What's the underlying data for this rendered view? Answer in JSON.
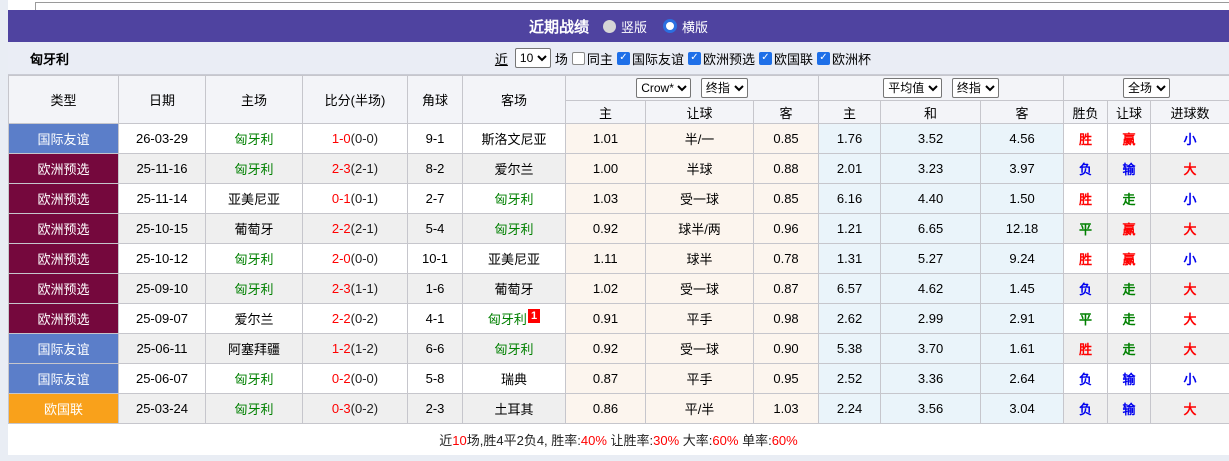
{
  "header": {
    "title": "近期战绩",
    "radio_vertical": "竖版",
    "radio_horizontal": "横版",
    "selected_layout": "横版"
  },
  "controls": {
    "team": "匈牙利",
    "recent_label": "近",
    "recent_count": "10",
    "matches_label": "场",
    "same_home": {
      "label": "同主",
      "checked": false
    },
    "filters": [
      {
        "label": "国际友谊",
        "checked": true
      },
      {
        "label": "欧洲预选",
        "checked": true
      },
      {
        "label": "欧国联",
        "checked": true
      },
      {
        "label": "欧洲杯",
        "checked": true
      }
    ]
  },
  "table": {
    "merged_headers": [
      "类型",
      "日期",
      "主场",
      "比分(半场)",
      "角球",
      "客场"
    ],
    "handicap_group": {
      "select_bookmaker": "Crow*",
      "select_stage": "终指",
      "cols": [
        "主",
        "让球",
        "客"
      ]
    },
    "europe_group": {
      "select_source": "平均值",
      "select_stage": "终指",
      "cols": [
        "主",
        "和",
        "客"
      ]
    },
    "result_group": {
      "select_scope": "全场",
      "cols": [
        "胜负",
        "让球",
        "进球数"
      ]
    },
    "rows": [
      {
        "type": "国际友谊",
        "type_class": "friendly",
        "date": "26-03-29",
        "home": "匈牙利",
        "home_green": true,
        "score": "1-0",
        "half": "(0-0)",
        "corner": "9-1",
        "away": "斯洛文尼亚",
        "away_green": false,
        "ah_home": "1.01",
        "ah_line": "半/一",
        "ah_away": "0.85",
        "eu_home": "1.76",
        "eu_draw": "3.52",
        "eu_away": "4.56",
        "res_wdl": "胜",
        "res_wdl_c": "red",
        "res_ah": "赢",
        "res_ah_c": "red",
        "res_goal": "小",
        "res_goal_c": "blue"
      },
      {
        "type": "欧洲预选",
        "type_class": "qualifier",
        "date": "25-11-16",
        "home": "匈牙利",
        "home_green": true,
        "score": "2-3",
        "half": "(2-1)",
        "corner": "8-2",
        "away": "爱尔兰",
        "away_green": false,
        "ah_home": "1.00",
        "ah_line": "半球",
        "ah_away": "0.88",
        "eu_home": "2.01",
        "eu_draw": "3.23",
        "eu_away": "3.97",
        "res_wdl": "负",
        "res_wdl_c": "blue",
        "res_ah": "输",
        "res_ah_c": "blue",
        "res_goal": "大",
        "res_goal_c": "red"
      },
      {
        "type": "欧洲预选",
        "type_class": "qualifier",
        "date": "25-11-14",
        "home": "亚美尼亚",
        "home_green": false,
        "score": "0-1",
        "half": "(0-1)",
        "corner": "2-7",
        "away": "匈牙利",
        "away_green": true,
        "ah_home": "1.03",
        "ah_line": "受一球",
        "ah_away": "0.85",
        "eu_home": "6.16",
        "eu_draw": "4.40",
        "eu_away": "1.50",
        "res_wdl": "胜",
        "res_wdl_c": "red",
        "res_ah": "走",
        "res_ah_c": "green",
        "res_goal": "小",
        "res_goal_c": "blue"
      },
      {
        "type": "欧洲预选",
        "type_class": "qualifier",
        "date": "25-10-15",
        "home": "葡萄牙",
        "home_green": false,
        "score": "2-2",
        "half": "(2-1)",
        "corner": "5-4",
        "away": "匈牙利",
        "away_green": true,
        "ah_home": "0.92",
        "ah_line": "球半/两",
        "ah_away": "0.96",
        "eu_home": "1.21",
        "eu_draw": "6.65",
        "eu_away": "12.18",
        "res_wdl": "平",
        "res_wdl_c": "green",
        "res_ah": "赢",
        "res_ah_c": "red",
        "res_goal": "大",
        "res_goal_c": "red"
      },
      {
        "type": "欧洲预选",
        "type_class": "qualifier",
        "date": "25-10-12",
        "home": "匈牙利",
        "home_green": true,
        "score": "2-0",
        "half": "(0-0)",
        "corner": "10-1",
        "away": "亚美尼亚",
        "away_green": false,
        "ah_home": "1.11",
        "ah_line": "球半",
        "ah_away": "0.78",
        "eu_home": "1.31",
        "eu_draw": "5.27",
        "eu_away": "9.24",
        "res_wdl": "胜",
        "res_wdl_c": "red",
        "res_ah": "赢",
        "res_ah_c": "red",
        "res_goal": "小",
        "res_goal_c": "blue"
      },
      {
        "type": "欧洲预选",
        "type_class": "qualifier",
        "date": "25-09-10",
        "home": "匈牙利",
        "home_green": true,
        "score": "2-3",
        "half": "(1-1)",
        "corner": "1-6",
        "away": "葡萄牙",
        "away_green": false,
        "ah_home": "1.02",
        "ah_line": "受一球",
        "ah_away": "0.87",
        "eu_home": "6.57",
        "eu_draw": "4.62",
        "eu_away": "1.45",
        "res_wdl": "负",
        "res_wdl_c": "blue",
        "res_ah": "走",
        "res_ah_c": "green",
        "res_goal": "大",
        "res_goal_c": "red"
      },
      {
        "type": "欧洲预选",
        "type_class": "qualifier",
        "date": "25-09-07",
        "home": "爱尔兰",
        "home_green": false,
        "score": "2-2",
        "half": "(0-2)",
        "corner": "4-1",
        "away": "匈牙利",
        "away_green": true,
        "away_badge": "1",
        "ah_home": "0.91",
        "ah_line": "平手",
        "ah_away": "0.98",
        "eu_home": "2.62",
        "eu_draw": "2.99",
        "eu_away": "2.91",
        "res_wdl": "平",
        "res_wdl_c": "green",
        "res_ah": "走",
        "res_ah_c": "green",
        "res_goal": "大",
        "res_goal_c": "red"
      },
      {
        "type": "国际友谊",
        "type_class": "friendly",
        "date": "25-06-11",
        "home": "阿塞拜疆",
        "home_green": false,
        "score": "1-2",
        "half": "(1-2)",
        "corner": "6-6",
        "away": "匈牙利",
        "away_green": true,
        "ah_home": "0.92",
        "ah_line": "受一球",
        "ah_away": "0.90",
        "eu_home": "5.38",
        "eu_draw": "3.70",
        "eu_away": "1.61",
        "res_wdl": "胜",
        "res_wdl_c": "red",
        "res_ah": "走",
        "res_ah_c": "green",
        "res_goal": "大",
        "res_goal_c": "red"
      },
      {
        "type": "国际友谊",
        "type_class": "friendly",
        "date": "25-06-07",
        "home": "匈牙利",
        "home_green": true,
        "score": "0-2",
        "half": "(0-0)",
        "corner": "5-8",
        "away": "瑞典",
        "away_green": false,
        "ah_home": "0.87",
        "ah_line": "平手",
        "ah_away": "0.95",
        "eu_home": "2.52",
        "eu_draw": "3.36",
        "eu_away": "2.64",
        "res_wdl": "负",
        "res_wdl_c": "blue",
        "res_ah": "输",
        "res_ah_c": "blue",
        "res_goal": "小",
        "res_goal_c": "blue"
      },
      {
        "type": "欧国联",
        "type_class": "nations",
        "date": "25-03-24",
        "home": "匈牙利",
        "home_green": true,
        "score": "0-3",
        "half": "(0-2)",
        "corner": "2-3",
        "away": "土耳其",
        "away_green": false,
        "ah_home": "0.86",
        "ah_line": "平/半",
        "ah_away": "1.03",
        "eu_home": "2.24",
        "eu_draw": "3.56",
        "eu_away": "3.04",
        "res_wdl": "负",
        "res_wdl_c": "blue",
        "res_ah": "输",
        "res_ah_c": "blue",
        "res_goal": "大",
        "res_goal_c": "red"
      }
    ]
  },
  "footer": {
    "segments": [
      {
        "t": "近",
        "red": false
      },
      {
        "t": "10",
        "red": true
      },
      {
        "t": "场,胜4平2负4, 胜率:",
        "red": false
      },
      {
        "t": "40%",
        "red": true
      },
      {
        "t": " 让胜率:",
        "red": false
      },
      {
        "t": "30%",
        "red": true
      },
      {
        "t": " 大率:",
        "red": false
      },
      {
        "t": "60%",
        "red": true
      },
      {
        "t": " 单率:",
        "red": false
      },
      {
        "t": "60%",
        "red": true
      }
    ]
  },
  "colors": {
    "header_purple": "#4f43a0",
    "friendly_blue": "#5b7ec9",
    "qualifier_maroon": "#75083d",
    "nations_orange": "#f9a11b",
    "team_green": "#008000",
    "win_red": "#ff0000",
    "loss_blue": "#0000ee",
    "handicap_tint": "#fcf5ee",
    "europe_tint": "#eaf4fa"
  }
}
